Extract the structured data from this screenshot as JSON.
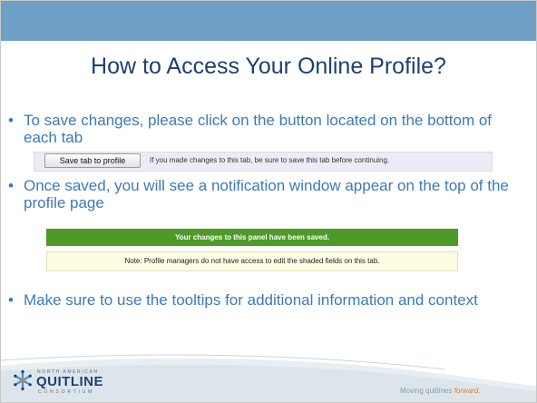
{
  "slide": {
    "title": "How to Access Your Online Profile?"
  },
  "bullets": [
    {
      "marker": "•",
      "text": "To save changes, please click on the button located on the bottom of each tab"
    },
    {
      "marker": "•",
      "text": "Once saved, you will see a notification window appear on the top of the profile page"
    },
    {
      "marker": "•",
      "text": "Make sure to use the tooltips for additional information and context"
    }
  ],
  "save_panel": {
    "button_label": "Save tab to profile",
    "note": "If you made changes to this tab, be sure to save this tab before continuing."
  },
  "notification": {
    "banner_text": "Your changes to this panel have been saved.",
    "note_text": "Note: Profile managers do not have access to edit the shaded fields on this tab."
  },
  "footer": {
    "logo_top": "NORTH AMERICAN",
    "logo_main": "QUITLINE",
    "logo_bottom": "CONSORTIUM",
    "tagline_start": "Moving quitlines",
    "tagline_emphasis": "forward."
  },
  "colors": {
    "band": "#6e9fc4",
    "title": "#1f3f6f",
    "bullet_text": "#3c7ab8",
    "banner_green": "#4d9a29",
    "note_bg": "#fdfde4",
    "tagline_accent": "#e07b2a"
  }
}
